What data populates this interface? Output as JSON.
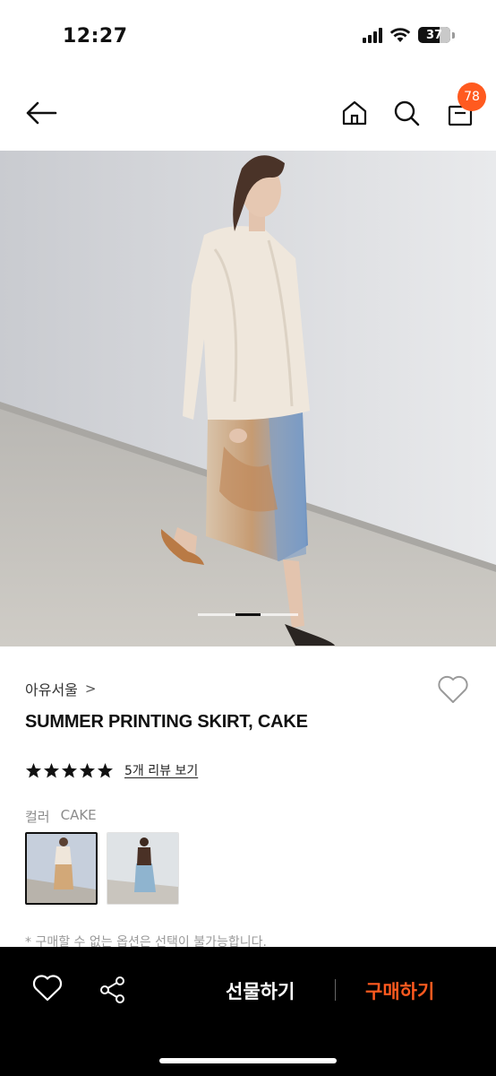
{
  "status_bar": {
    "time": "12:27",
    "battery": "37",
    "icons": [
      "signal-icon",
      "wifi-icon",
      "battery-icon"
    ]
  },
  "nav": {
    "icons": [
      "back-arrow-icon",
      "home-icon",
      "search-icon",
      "shopping-bag-icon"
    ],
    "cart_count": "78"
  },
  "carousel": {
    "current_slide_fraction": 0.5
  },
  "product": {
    "brand": "아유서울",
    "brand_chevron": ">",
    "title": "SUMMER PRINTING SKIRT, CAKE",
    "rating_stars": 5,
    "review_link": "5개 리뷰 보기",
    "color_label": "컬러",
    "color_value": "CAKE",
    "option_note": "* 구매할 수 없는 옵션은 선택이 불가능합니다."
  },
  "bottom_bar": {
    "gift_label": "선물하기",
    "buy_label": "구매하기",
    "icons": [
      "heart-icon",
      "share-icon"
    ]
  },
  "colors": {
    "accent": "#ff5a1f",
    "bottom_bar_bg": "#000000",
    "text_primary": "#111111",
    "text_muted": "#8c8c8c"
  }
}
